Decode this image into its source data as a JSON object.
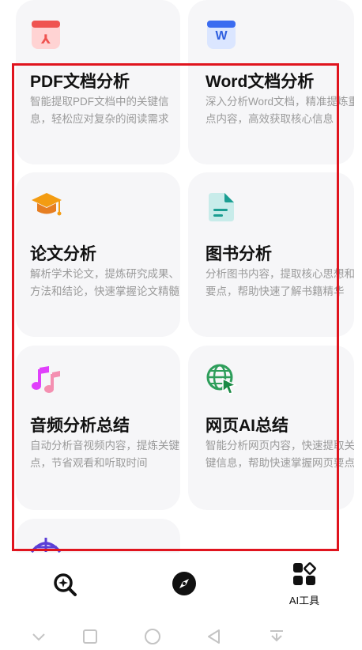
{
  "cards": [
    {
      "title": "PDF文档分析",
      "desc": "智能提取PDF文档中的关键信息，轻松应对复杂的阅读需求",
      "icon": "pdf-icon"
    },
    {
      "title": "Word文档分析",
      "desc": "深入分析Word文档，精准提炼重点内容，高效获取核心信息",
      "icon": "word-icon",
      "icon_text": "W"
    },
    {
      "title": "论文分析",
      "desc": "解析学术论文，提炼研究成果、方法和结论，快速掌握论文精髓",
      "icon": "graduation-cap-icon"
    },
    {
      "title": "图书分析",
      "desc": "分析图书内容，提取核心思想和要点，帮助快速了解书籍精华",
      "icon": "book-icon"
    },
    {
      "title": "音频分析总结",
      "desc": "自动分析音视频内容，提炼关键点，节省观看和听取时间",
      "icon": "music-note-icon"
    },
    {
      "title": "网页AI总结",
      "desc": "智能分析网页内容，快速提取关键信息，帮助快速掌握网页要点",
      "icon": "web-globe-icon"
    }
  ],
  "bottom_nav": {
    "items": [
      {
        "label": "",
        "icon": "ai-search-icon"
      },
      {
        "label": "",
        "icon": "compass-icon"
      },
      {
        "label": "AI工具",
        "icon": "grid-tools-icon"
      }
    ]
  },
  "colors": {
    "highlight": "#e0141e",
    "card_bg": "#f6f6f8",
    "desc": "#9a9a9a"
  }
}
